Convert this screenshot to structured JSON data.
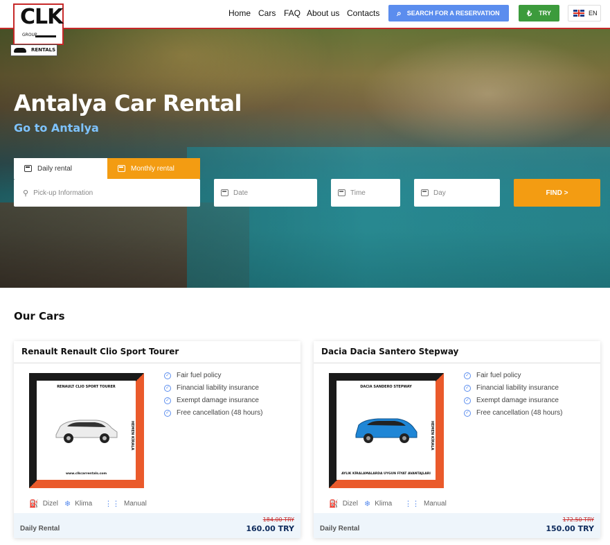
{
  "header": {
    "logo_text": "CLK",
    "logo_group": "GROUP",
    "logo_rentals": "RENTALS",
    "nav": [
      "Home",
      "Cars",
      "FAQ",
      "About us",
      "Contacts"
    ],
    "search_reservation": "SEARCH FOR A RESERVATION",
    "currency": "TRY",
    "language": "EN"
  },
  "hero": {
    "title": "Antalya Car Rental",
    "subtitle": "Go to Antalya",
    "tabs": {
      "daily": "Daily rental",
      "monthly": "Monthly rental"
    },
    "fields": {
      "pickup": "Pick-up Information",
      "date": "Date",
      "time": "Time",
      "day": "Day"
    },
    "find": "FIND  >"
  },
  "our_cars": {
    "title": "Our Cars",
    "cars": [
      {
        "name": "Renault Renault Clio Sport Tourer",
        "thumb_top": "RENAULT CLIO SPORT TOURER",
        "thumb_side": "HEMEN KİRALA",
        "thumb_bottom": "www.clkcarrentals.com",
        "features": [
          "Fair fuel policy",
          "Financial liability insurance",
          "Exempt damage insurance",
          "Free cancellation (48 hours)"
        ],
        "specs": {
          "fuel": "Dizel",
          "ac": "Klima",
          "gear": "Manual"
        },
        "label": "Daily Rental",
        "old_price": "184.00 TRY",
        "price": "160.00 TRY",
        "car_color": "#e9e9e9"
      },
      {
        "name": "Dacia Dacia Santero Stepway",
        "thumb_top": "DACIA SANDERO STEPWAY",
        "thumb_side": "HEMEN KİRALA",
        "thumb_bottom": "AYLIK KİRALAMALARDA UYGUN FİYAT AVANTAJLARI",
        "features": [
          "Fair fuel policy",
          "Financial liability insurance",
          "Exempt damage insurance",
          "Free cancellation (48 hours)"
        ],
        "specs": {
          "fuel": "Dizel",
          "ac": "Klima",
          "gear": "Manual"
        },
        "label": "Daily Rental",
        "old_price": "172.50 TRY",
        "price": "150.00 TRY",
        "car_color": "#1f86d6"
      }
    ]
  },
  "colors": {
    "accent_orange": "#f39c12",
    "reservation_blue": "#5b8dee",
    "try_green": "#3c9b3c",
    "brand_red": "#c62828",
    "price_navy": "#0d2a5c"
  }
}
